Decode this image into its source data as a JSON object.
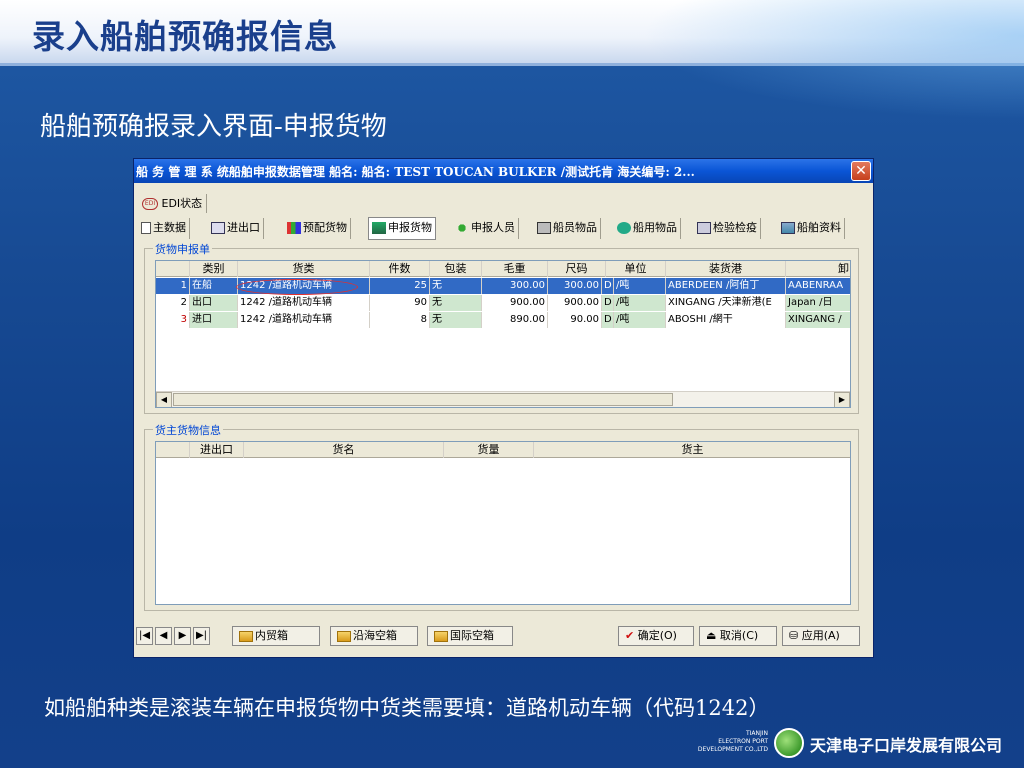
{
  "slide": {
    "title": "录入船舶预确报信息",
    "subtitle": "船舶预确报录入界面-申报货物",
    "note": "如船舶种类是滚装车辆在申报货物中货类需要填：道路机动车辆（代码1242）",
    "brand": {
      "en_line1": "TIANJIN",
      "en_line2": "ELECTRON PORT",
      "en_line3": "DEVELOPMENT CO.,LTD",
      "cn": "天津电子口岸发展有限公司"
    }
  },
  "window": {
    "title": "船 务 管 理 系 统船舶申报数据管理   船名: 船名: TEST TOUCAN BULKER /测试托肯   海关编号: 2...",
    "close_glyph": "✕",
    "edi_status": "EDI状态",
    "edi_badge": "EDI",
    "tabs": [
      {
        "label": "主数据"
      },
      {
        "label": "进出口"
      },
      {
        "label": "预配货物"
      },
      {
        "label": "申报货物"
      },
      {
        "label": "申报人员"
      },
      {
        "label": "船员物品"
      },
      {
        "label": "船用物品"
      },
      {
        "label": "检验检疫"
      },
      {
        "label": "船舶资料"
      }
    ],
    "cargo_group": {
      "legend": "货物申报单",
      "columns": [
        "类别",
        "货类",
        "件数",
        "包装",
        "毛重",
        "尺码",
        "单位",
        "装货港",
        "卸"
      ],
      "rows": [
        {
          "idx": "1",
          "type": "在船",
          "cargo": "1242 /道路机动车辆",
          "pieces": "25",
          "pack": "无",
          "gross": "300.00",
          "measure": "300.00",
          "unit_code": "D",
          "unit": "/吨",
          "load_port": "ABERDEEN /阿伯丁",
          "disc_port": "AABENRAA"
        },
        {
          "idx": "2",
          "type": "出口",
          "cargo": "1242 /道路机动车辆",
          "pieces": "90",
          "pack": "无",
          "gross": "900.00",
          "measure": "900.00",
          "unit_code": "D",
          "unit": "/吨",
          "load_port": "XINGANG /天津新港(E",
          "disc_port": "Japan /日"
        },
        {
          "idx": "3",
          "type": "进口",
          "cargo": "1242 /道路机动车辆",
          "pieces": "8",
          "pack": "无",
          "gross": "890.00",
          "measure": "90.00",
          "unit_code": "D",
          "unit": "/吨",
          "load_port": "ABOSHI /網干",
          "disc_port": "XINGANG /"
        }
      ]
    },
    "owner_group": {
      "legend": "货主货物信息",
      "columns": [
        "进出口",
        "货名",
        "货量",
        "货主"
      ]
    },
    "bottom": {
      "nav": [
        "|◀",
        "◀",
        "▶",
        "▶|"
      ],
      "buttons": [
        "内贸箱",
        "沿海空箱",
        "国际空箱"
      ],
      "ok": "确定(O)",
      "cancel": "取消(C)",
      "apply": "应用(A)"
    }
  }
}
